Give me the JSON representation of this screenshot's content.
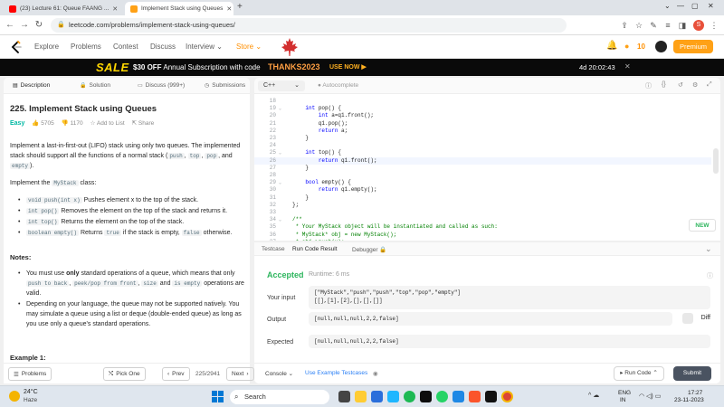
{
  "browser": {
    "tabs": [
      {
        "title": "(23) Lecture 61: Queue FAANG ...",
        "color": "#ff0000"
      },
      {
        "title": "Implement Stack using Queues",
        "color": "#ffa116"
      }
    ],
    "url": "leetcode.com/problems/implement-stack-using-queues/",
    "profile_initial": "S"
  },
  "nav": {
    "links": [
      "Explore",
      "Problems",
      "Contest",
      "Discuss",
      "Interview",
      "Store"
    ],
    "streak": "10",
    "premium": "Premium"
  },
  "banner": {
    "sale": "SALE",
    "text_bold": "$30 OFF",
    "text": "Annual Subscription with code",
    "code": "THANKS2023",
    "cta": "USE NOW",
    "countdown": "4d 20:02:43"
  },
  "left": {
    "tabs": [
      "Description",
      "Solution",
      "Discuss (999+)",
      "Submissions"
    ],
    "title": "225. Implement Stack using Queues",
    "difficulty": "Easy",
    "likes": "5705",
    "dislikes": "1170",
    "add_to_list": "Add to List",
    "share": "Share",
    "p1a": "Implement a last-in-first-out (LIFO) stack using only two queues. The implemented stack should support all the functions of a normal stack (",
    "p1_c1": "push",
    "p1_c2": "top",
    "p1_c3": "pop",
    "p1_and": ", and",
    "p1_c4": "empty",
    "p1b": ").",
    "p2a": "Implement the",
    "p2_c": "MyStack",
    "p2b": "class:",
    "methods": [
      {
        "code": "void push(int x)",
        "desc": "Pushes element x to the top of the stack."
      },
      {
        "code": "int pop()",
        "desc": "Removes the element on the top of the stack and returns it."
      },
      {
        "code": "int top()",
        "desc": "Returns the element on the top of the stack."
      },
      {
        "code": "boolean empty()",
        "desc": "Returns",
        "code2": "true",
        "desc2": "if the stack is empty,",
        "code3": "false",
        "desc3": "otherwise."
      }
    ],
    "notes_label": "Notes:",
    "note1a": "You must use",
    "note1_only": "only",
    "note1b": "standard operations of a queue, which means that only",
    "note1_c1": "push to back",
    "note1_c2": "peek/pop from front",
    "note1_c3": "size",
    "note1_and": "and",
    "note1_c4": "is empty",
    "note1c": "operations are valid.",
    "note2": "Depending on your language, the queue may not be supported natively. You may simulate a queue using a list or deque (double-ended queue) as long as you use only a queue's standard operations.",
    "example_label": "Example 1:",
    "footer": {
      "problems": "Problems",
      "pick_one": "Pick One",
      "prev": "Prev",
      "pager": "225/2941",
      "next": "Next"
    }
  },
  "editor": {
    "language": "C++",
    "autocomplete": "Autocomplete",
    "lines": [
      {
        "n": "18",
        "t": "",
        "k": ""
      },
      {
        "n": "19",
        "t": "    int pop() {",
        "k": "",
        "fold": "v"
      },
      {
        "n": "20",
        "t": "        int a=q1.front();",
        "k": ""
      },
      {
        "n": "21",
        "t": "        q1.pop();",
        "k": ""
      },
      {
        "n": "22",
        "t": "        return a;",
        "k": ""
      },
      {
        "n": "23",
        "t": "    }",
        "k": ""
      },
      {
        "n": "24",
        "t": "",
        "k": ""
      },
      {
        "n": "25",
        "t": "    int top() {",
        "k": "",
        "fold": "v"
      },
      {
        "n": "26",
        "t": "        return q1.front();",
        "k": "",
        "hl": true
      },
      {
        "n": "27",
        "t": "    }",
        "k": ""
      },
      {
        "n": "28",
        "t": "",
        "k": ""
      },
      {
        "n": "29",
        "t": "    bool empty() {",
        "k": "",
        "fold": "v"
      },
      {
        "n": "30",
        "t": "        return q1.empty();",
        "k": ""
      },
      {
        "n": "31",
        "t": "    }",
        "k": ""
      },
      {
        "n": "32",
        "t": "};",
        "k": ""
      },
      {
        "n": "33",
        "t": "",
        "k": ""
      },
      {
        "n": "34",
        "t": "/**",
        "k": "cm",
        "fold": "v"
      },
      {
        "n": "35",
        "t": " * Your MyStack object will be instantiated and called as such:",
        "k": "cm"
      },
      {
        "n": "36",
        "t": " * MyStack* obj = new MyStack();",
        "k": "cm"
      },
      {
        "n": "37",
        "t": " * obj->push(x);",
        "k": "cm"
      },
      {
        "n": "38",
        "t": " * int param_2 = obj->pop();",
        "k": "cm"
      }
    ],
    "new_badge": "NEW"
  },
  "result": {
    "tabs": [
      "Testcase",
      "Run Code Result",
      "Debugger"
    ],
    "status": "Accepted",
    "runtime": "Runtime: 6 ms",
    "input_label": "Your input",
    "input_line1": "[\"MyStack\",\"push\",\"push\",\"top\",\"pop\",\"empty\"]",
    "input_line2": "[[],[1],[2],[],[],[]]",
    "output_label": "Output",
    "output": "[null,null,null,2,2,false]",
    "diff": "Diff",
    "expected_label": "Expected",
    "expected": "[null,null,null,2,2,false]",
    "console": "Console",
    "use_example": "Use Example Testcases",
    "run": "Run Code",
    "submit": "Submit"
  },
  "taskbar": {
    "temp": "24°C",
    "weather": "Haze",
    "search": "Search",
    "lang1": "ENG",
    "lang2": "IN",
    "time": "17:27",
    "date": "23-11-2023"
  }
}
